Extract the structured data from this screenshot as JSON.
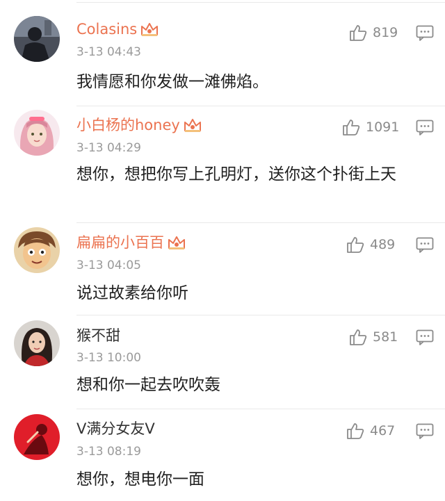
{
  "comments": [
    {
      "username": "Colasins",
      "vip": true,
      "timestamp": "3-13 04:43",
      "likes": "819",
      "content": "我情愿和你发做一滩佛焰。",
      "avatar_icon": "dark-silhouette-avatar"
    },
    {
      "username": "小白杨的honey",
      "vip": true,
      "timestamp": "3-13 04:29",
      "likes": "1091",
      "content": "想你，想把你写上孔明灯，送你这个扑街上天",
      "avatar_icon": "pink-hair-girl-avatar"
    },
    {
      "username": "扁扁的小百百",
      "vip": true,
      "timestamp": "3-13 04:05",
      "likes": "489",
      "content": "说过故素给你听",
      "avatar_icon": "cartoon-boy-avatar"
    },
    {
      "username": "猴不甜",
      "vip": false,
      "timestamp": "3-13 10:00",
      "likes": "581",
      "content": "想和你一起去吹吹轰",
      "avatar_icon": "girl-portrait-avatar"
    },
    {
      "username": "V满分女友V",
      "vip": false,
      "timestamp": "3-13 08:19",
      "likes": "467",
      "content": "想你，想电你一面",
      "avatar_icon": "red-figure-avatar"
    }
  ],
  "colors": {
    "vip_name": "#eb7350",
    "normal_name": "#333333",
    "timestamp": "#9a9a9a",
    "content": "#1f1f1f",
    "icon": "#8a8a8a"
  }
}
